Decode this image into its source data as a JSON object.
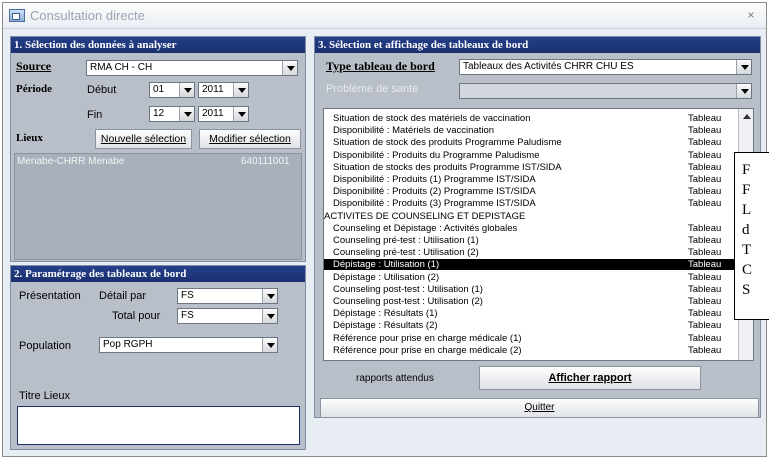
{
  "window": {
    "title": "Consultation directe",
    "close": "×"
  },
  "section1": {
    "header": "1. Sélection des données à analyser",
    "source_label": "Source",
    "source_value": "RMA CH - CH",
    "periode_label": "Période",
    "debut_label": "Début",
    "debut_month": "01",
    "debut_year": "2011",
    "fin_label": "Fin",
    "fin_month": "12",
    "fin_year": "2011",
    "lieux_label": "Lieux",
    "nouvelle_btn": "Nouvelle sélection",
    "modifier_btn": "Modifier sélection",
    "lieux_items": [
      {
        "name": "Menabe-CHRR Menabe",
        "code": "640111001"
      }
    ]
  },
  "section2": {
    "header": "2. Paramétrage des tableaux de bord",
    "presentation_label": "Présentation",
    "detail_label": "Détail par",
    "detail_value": "FS",
    "total_label": "Total pour",
    "total_value": "FS",
    "population_label": "Population",
    "population_value": "Pop RGPH",
    "titre_label": "Titre Lieux",
    "titre_value": ""
  },
  "section3": {
    "header": "3. Sélection et affichage des tableaux de bord",
    "type_label": "Type tableau de bord",
    "type_value": "Tableaux des Activités CHRR CHU ES",
    "probleme_label": "Problème de santé",
    "probleme_value": "",
    "rows": [
      {
        "name": "Situation de stock des matériels de vaccination",
        "type": "Tableau",
        "indent": true
      },
      {
        "name": "Disponibilité : Matériels de vaccination",
        "type": "Tableau",
        "indent": true
      },
      {
        "name": "Situation de stock des produits Programme Paludisme",
        "type": "Tableau",
        "indent": true
      },
      {
        "name": "Disponibilité : Produits du Programme Paludisme",
        "type": "Tableau",
        "indent": true
      },
      {
        "name": "Situation de stocks des produits Programme IST/SIDA",
        "type": "Tableau",
        "indent": true
      },
      {
        "name": "Disponibilité : Produits (1) Programme IST/SIDA",
        "type": "Tableau",
        "indent": true
      },
      {
        "name": "Disponibilité : Produits (2) Programme IST/SIDA",
        "type": "Tableau",
        "indent": true
      },
      {
        "name": "Disponibilité : Produits (3) Programme IST/SIDA",
        "type": "Tableau",
        "indent": true
      },
      {
        "name": "ACTIVITES DE COUNSELING ET DEPISTAGE",
        "type": "",
        "indent": false
      },
      {
        "name": "Counseling et Dépistage : Activités globales",
        "type": "Tableau",
        "indent": true
      },
      {
        "name": "Counseling pré-test : Utilisation (1)",
        "type": "Tableau",
        "indent": true
      },
      {
        "name": "Counseling pré-test : Utilisation (2)",
        "type": "Tableau",
        "indent": true
      },
      {
        "name": "Dépistage : Utilisation (1)",
        "type": "Tableau",
        "indent": true,
        "selected": true
      },
      {
        "name": "Dépistage : Utilisation (2)",
        "type": "Tableau",
        "indent": true
      },
      {
        "name": "Counseling post-test : Utilisation (1)",
        "type": "Tableau",
        "indent": true
      },
      {
        "name": "Counseling post-test : Utilisation (2)",
        "type": "Tableau",
        "indent": true
      },
      {
        "name": "Dépistage : Résultats (1)",
        "type": "Tableau",
        "indent": true
      },
      {
        "name": "Dépistage : Résultats (2)",
        "type": "Tableau",
        "indent": true
      },
      {
        "name": "Référence pour prise en charge médicale (1)",
        "type": "Tableau",
        "indent": true
      },
      {
        "name": "Référence pour prise en charge médicale (2)",
        "type": "Tableau",
        "indent": true
      }
    ],
    "rapports_label": "rapports attendus",
    "afficher_btn": "Afficher rapport",
    "quitter_btn": "Quitter"
  },
  "overlay_note": [
    "F",
    "F",
    "L",
    "d",
    "T",
    "C",
    "S"
  ]
}
